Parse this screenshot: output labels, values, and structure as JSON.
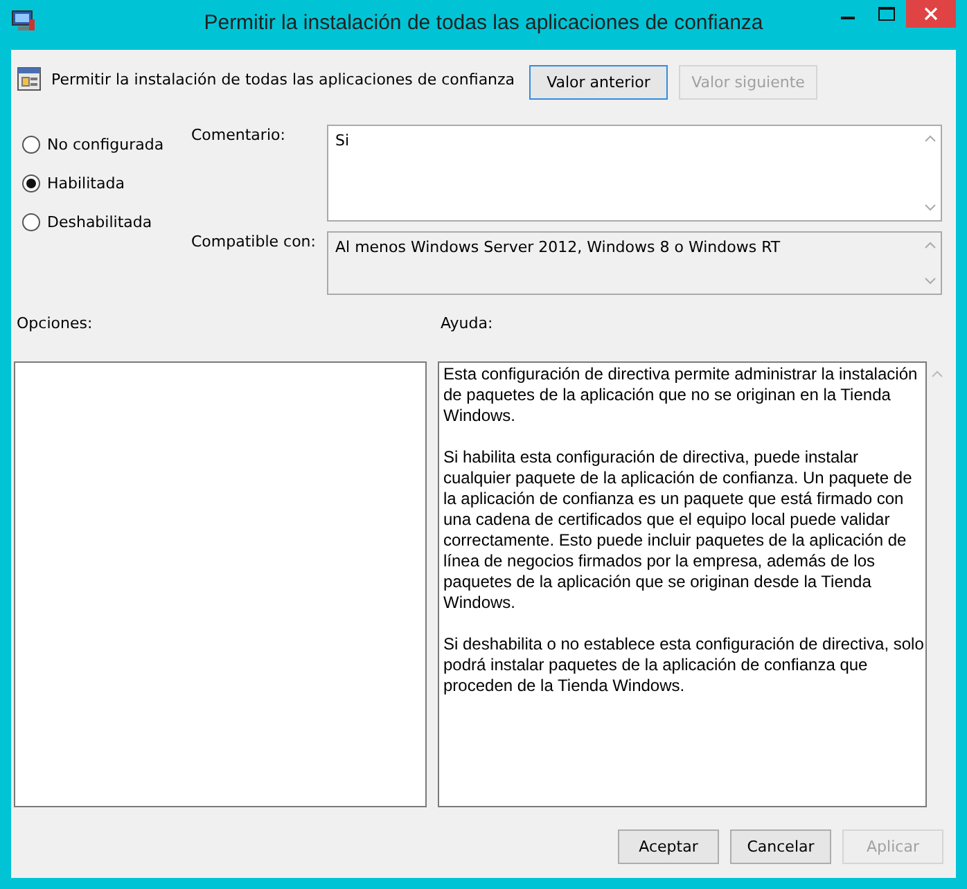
{
  "window": {
    "title": "Permitir la instalación de todas las aplicaciones de confianza"
  },
  "header": {
    "policy_name": "Permitir la instalación de todas las aplicaciones de confianza",
    "buttons": [
      {
        "label": "Valor anterior",
        "disabled": false,
        "focused": true
      },
      {
        "label": "Valor siguiente",
        "disabled": true,
        "focused": false
      }
    ]
  },
  "state_options": [
    {
      "label": "No configurada",
      "selected": false
    },
    {
      "label": "Habilitada",
      "selected": true
    },
    {
      "label": "Deshabilitada",
      "selected": false
    }
  ],
  "comment": {
    "label": "Comentario:",
    "value": "Si"
  },
  "supported": {
    "label": "Compatible con:",
    "value": "Al menos Windows Server 2012, Windows 8 o Windows RT"
  },
  "options": {
    "label": "Opciones:"
  },
  "help": {
    "label": "Ayuda:",
    "paragraphs": [
      "Esta configuración de directiva permite administrar la instalación de paquetes de la aplicación que no se originan en la Tienda Windows.",
      "Si habilita esta configuración de directiva, puede instalar cualquier paquete de la aplicación de confianza. Un paquete de la aplicación de confianza es un paquete que está firmado con una cadena de certificados que el equipo local puede validar correctamente. Esto puede incluir paquetes de la aplicación de línea de negocios firmados por la empresa, además de los paquetes de la aplicación que se originan desde la Tienda Windows.",
      "Si deshabilita o no establece esta configuración de directiva, solo podrá instalar paquetes de la aplicación de confianza que proceden de la Tienda Windows."
    ]
  },
  "buttons": [
    {
      "label": "Aceptar",
      "disabled": false
    },
    {
      "label": "Cancelar",
      "disabled": false
    },
    {
      "label": "Aplicar",
      "disabled": true
    }
  ]
}
